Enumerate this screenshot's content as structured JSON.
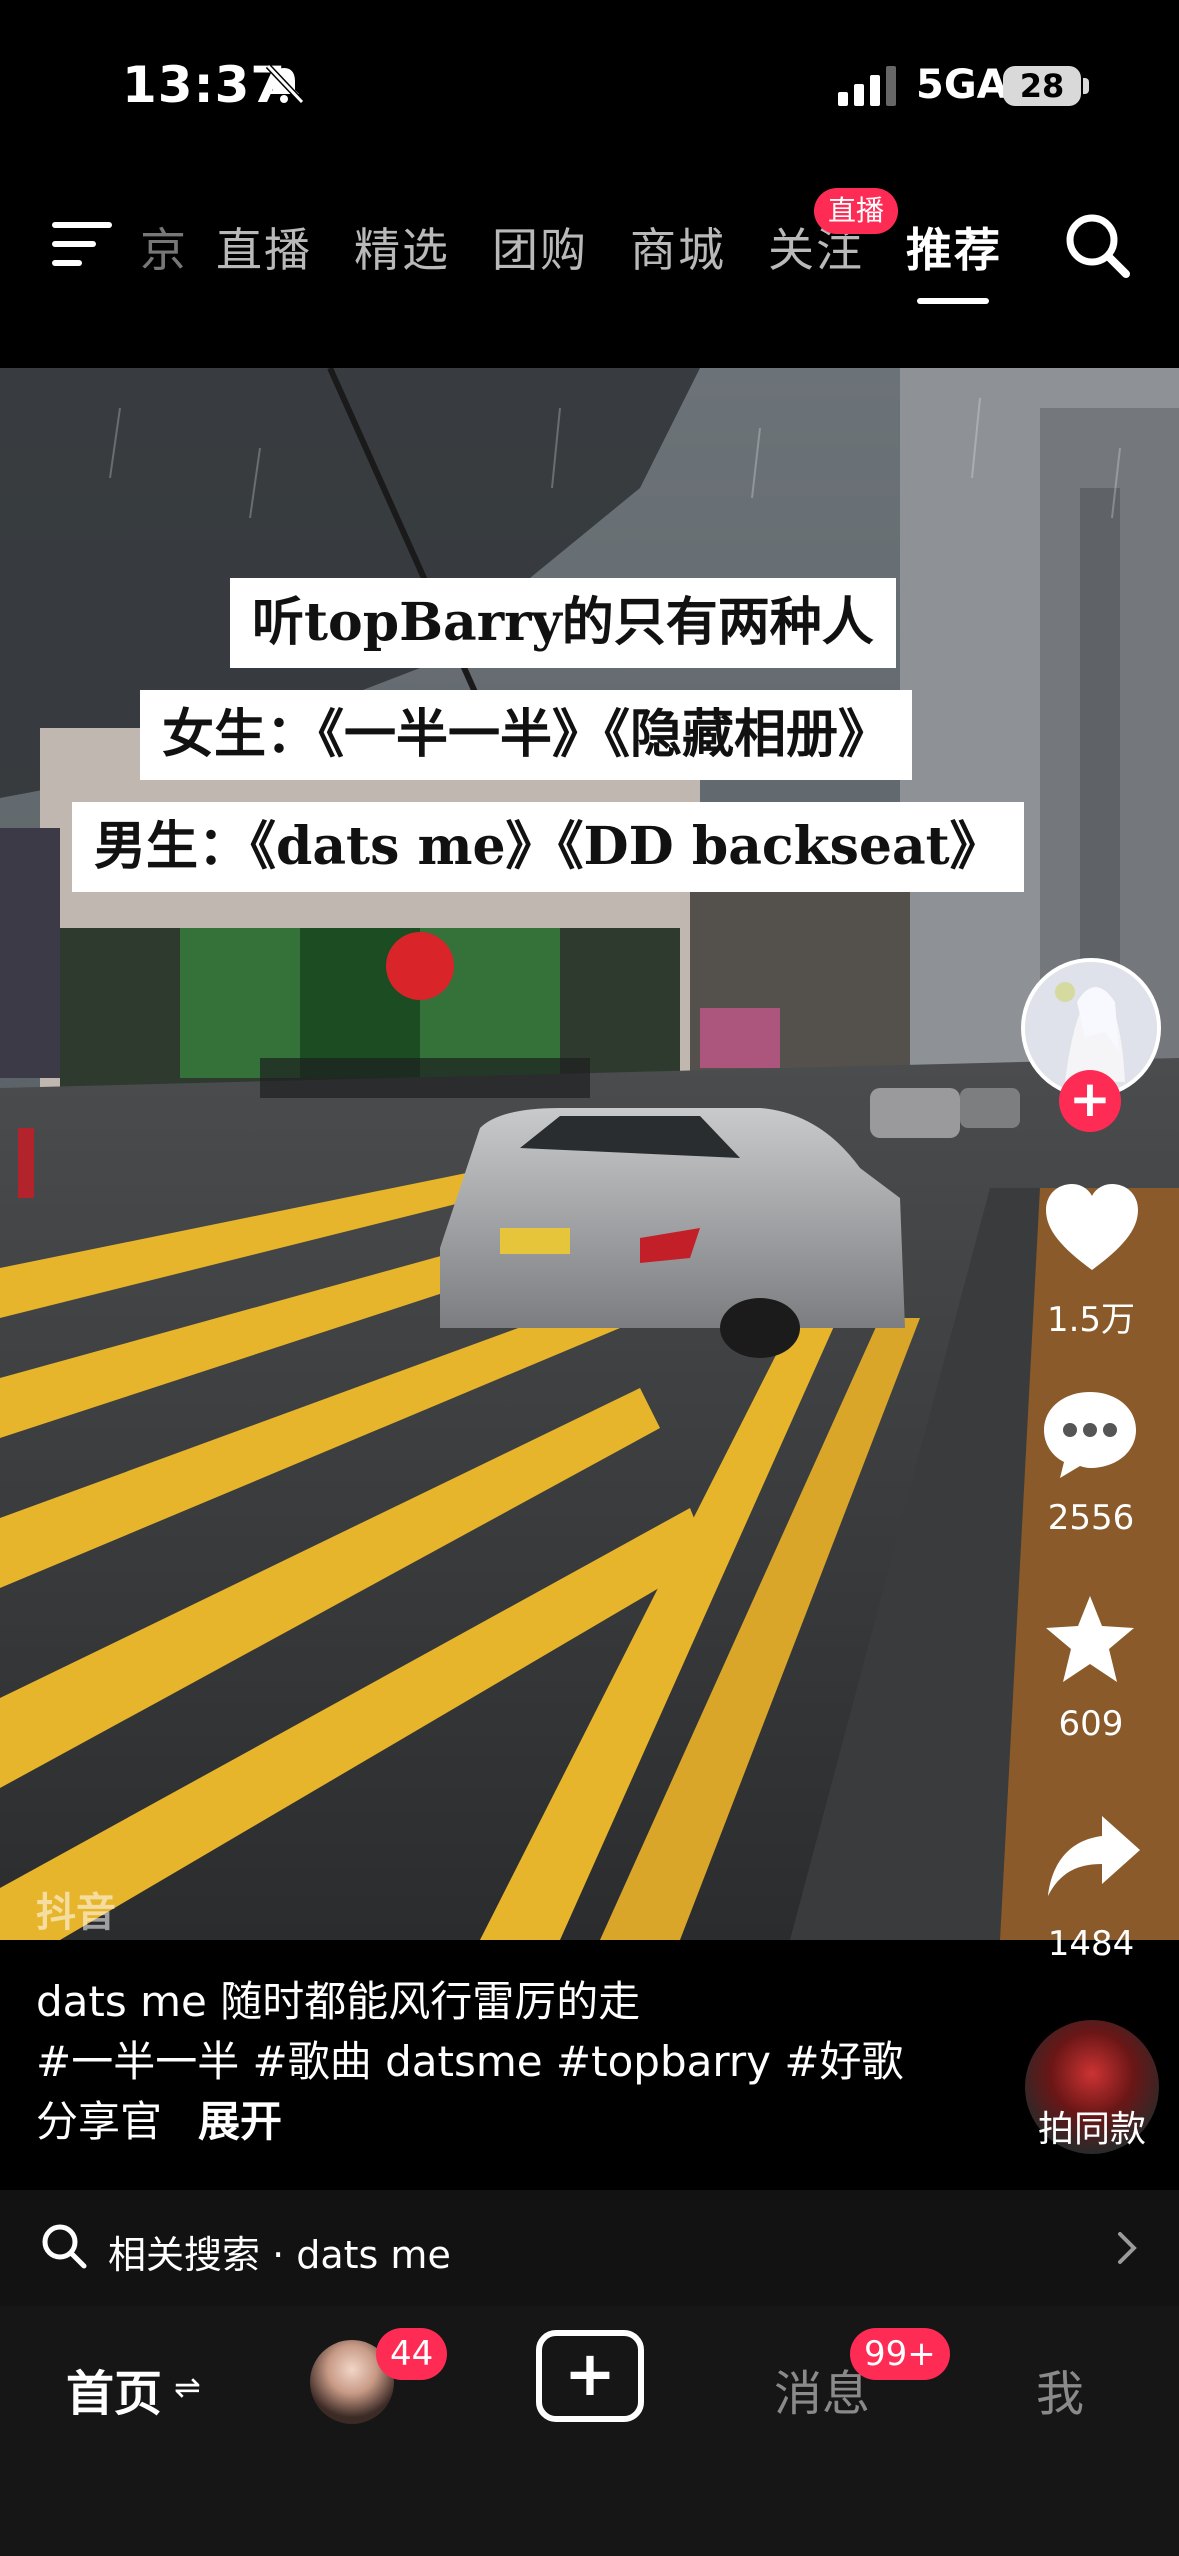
{
  "status_bar": {
    "time": "13:37",
    "network": "5GA",
    "battery": "28"
  },
  "top_nav": {
    "tabs": [
      {
        "label": "京",
        "state": "partial"
      },
      {
        "label": "直播",
        "state": "normal"
      },
      {
        "label": "精选",
        "state": "normal"
      },
      {
        "label": "团购",
        "state": "normal"
      },
      {
        "label": "商城",
        "state": "normal"
      },
      {
        "label": "关注",
        "state": "normal"
      },
      {
        "label": "推荐",
        "state": "active"
      }
    ],
    "live_badge": "直播",
    "icons": [
      "menu-icon",
      "search-icon"
    ]
  },
  "video": {
    "caption_lines": [
      "听topBarry的只有两种人",
      "女生：《一半一半》《隐藏相册》",
      "男生：《dats me》《DD backseat》"
    ],
    "watermark": "抖音"
  },
  "actions": {
    "likes": "1.5万",
    "comments": "2556",
    "favorites": "609",
    "shares": "1484",
    "same_style_label": "拍同款"
  },
  "description": {
    "line1": "dats me 随时都能风行雷厉的走",
    "line2": "#一半一半 #歌曲 datsme #topbarry #好歌",
    "line3": "分享官",
    "expand": "展开"
  },
  "related_search": {
    "label": "相关搜索 · dats me"
  },
  "bottom_nav": {
    "home": "首页",
    "home_switch": "⇌",
    "friend_badge": "44",
    "create": "+",
    "messages": "消息",
    "messages_badge": "99+",
    "me": "我"
  },
  "colors": {
    "accent": "#fe2c55",
    "road_yellow": "#e7b52b",
    "background": "#000000"
  }
}
